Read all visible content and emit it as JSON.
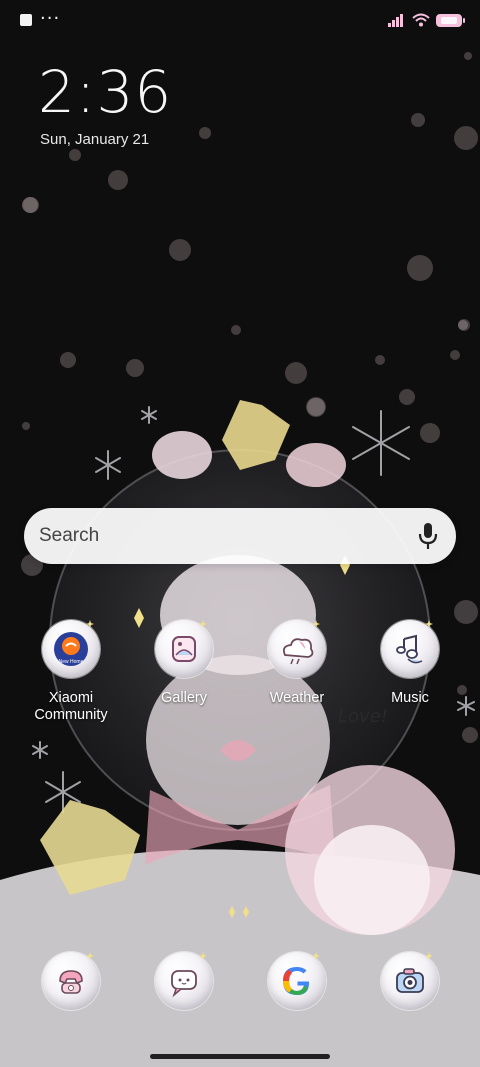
{
  "status_bar": {
    "dots": "···",
    "accent_color": "#f6c1dc"
  },
  "clock": {
    "time": "2:36",
    "date": "Sun, January 21"
  },
  "search": {
    "placeholder": "Search"
  },
  "apps_row": [
    {
      "label": "Xiaomi\nCommunity",
      "icon": "xiaomi-community-icon"
    },
    {
      "label": "Gallery",
      "icon": "gallery-icon"
    },
    {
      "label": "Weather",
      "icon": "weather-icon"
    },
    {
      "label": "Music",
      "icon": "music-icon"
    }
  ],
  "dock": [
    {
      "icon": "phone-icon"
    },
    {
      "icon": "messages-icon"
    },
    {
      "icon": "google-icon"
    },
    {
      "icon": "camera-icon"
    }
  ],
  "wallpaper": {
    "text": "Love!",
    "colors": {
      "pink": "#e9a6b8",
      "cream": "#f1e0a0",
      "snow": "#d8d6da"
    }
  },
  "icon_badge": {
    "text": "New Home"
  }
}
